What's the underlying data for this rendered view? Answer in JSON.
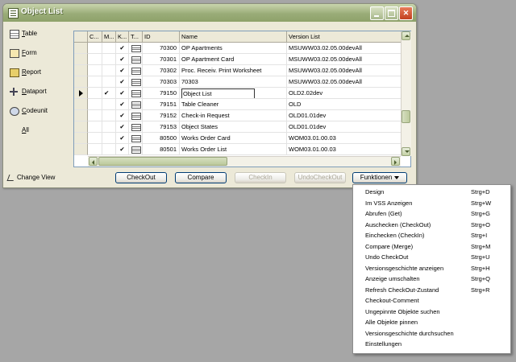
{
  "window": {
    "title": "Object List"
  },
  "nav": [
    {
      "label": "Table",
      "icon": "table-icon"
    },
    {
      "label": "Form",
      "icon": "form-icon"
    },
    {
      "label": "Report",
      "icon": "report-icon"
    },
    {
      "label": "Dataport",
      "icon": "dataport-icon"
    },
    {
      "label": "Codeunit",
      "icon": "codeunit-icon"
    },
    {
      "label": "All",
      "icon": ""
    }
  ],
  "grid": {
    "columns": [
      "C...",
      "M...",
      "K...",
      "T...",
      "ID",
      "Name",
      "Version List"
    ],
    "rows": [
      {
        "k": "✔",
        "id": "70300",
        "name": "OP Apartments",
        "version": "MSUWW03.02.05.00devAll"
      },
      {
        "k": "✔",
        "id": "70301",
        "name": "OP Apartment Card",
        "version": "MSUWW03.02.05.00devAll"
      },
      {
        "k": "✔",
        "id": "70302",
        "name": "Proc. Receiv. Print Worksheet",
        "version": "MSUWW03.02.05.00devAll"
      },
      {
        "k": "✔",
        "id": "70303",
        "name": "70303",
        "version": "MSUWW03.02.05.00devAll"
      },
      {
        "k": "✔",
        "m": "✔",
        "id": "79150",
        "name": "Object List",
        "version": "OLD2.02dev",
        "current": true
      },
      {
        "k": "✔",
        "id": "79151",
        "name": "Table Cleaner",
        "version": "OLD"
      },
      {
        "k": "✔",
        "id": "79152",
        "name": "Check-in Request",
        "version": "OLD01.01dev"
      },
      {
        "k": "✔",
        "id": "79153",
        "name": "Object States",
        "version": "OLD01.01dev"
      },
      {
        "k": "✔",
        "id": "80500",
        "name": "Works Order Card",
        "version": "WOM03.01.00.03"
      },
      {
        "k": "✔",
        "id": "80501",
        "name": "Works Order List",
        "version": "WOM03.01.00.03"
      }
    ]
  },
  "bottom": {
    "change_view": "Change View",
    "checkout": "CheckOut",
    "compare": "Compare",
    "checkin": "CheckIn",
    "undo_checkout": "UndoCheckOut",
    "funktionen": "Funktionen"
  },
  "menu": [
    {
      "label": "Design",
      "shortcut": "Strg+D"
    },
    {
      "label": "Im VSS Anzeigen",
      "shortcut": "Strg+W"
    },
    {
      "label": "Abrufen (Get)",
      "shortcut": "Strg+G"
    },
    {
      "label": "Auschecken (CheckOut)",
      "shortcut": "Strg+O"
    },
    {
      "label": "Einchecken (CheckIn)",
      "shortcut": "Strg+I"
    },
    {
      "label": "Compare (Merge)",
      "shortcut": "Strg+M"
    },
    {
      "label": "Undo CheckOut",
      "shortcut": "Strg+U"
    },
    {
      "label": "Versionsgeschichte anzeigen",
      "shortcut": "Strg+H"
    },
    {
      "label": "Anzeige umschalten",
      "shortcut": "Strg+Q"
    },
    {
      "label": "Refresh CheckOut-Zustand",
      "shortcut": "Strg+R"
    },
    {
      "label": "Checkout-Comment",
      "shortcut": ""
    },
    {
      "label": "Ungepinnte Objekte suchen",
      "shortcut": ""
    },
    {
      "label": "Alle Objekte pinnen",
      "shortcut": ""
    },
    {
      "label": "Versionsgeschichte durchsuchen",
      "shortcut": ""
    },
    {
      "label": "Einstellungen",
      "shortcut": ""
    }
  ]
}
